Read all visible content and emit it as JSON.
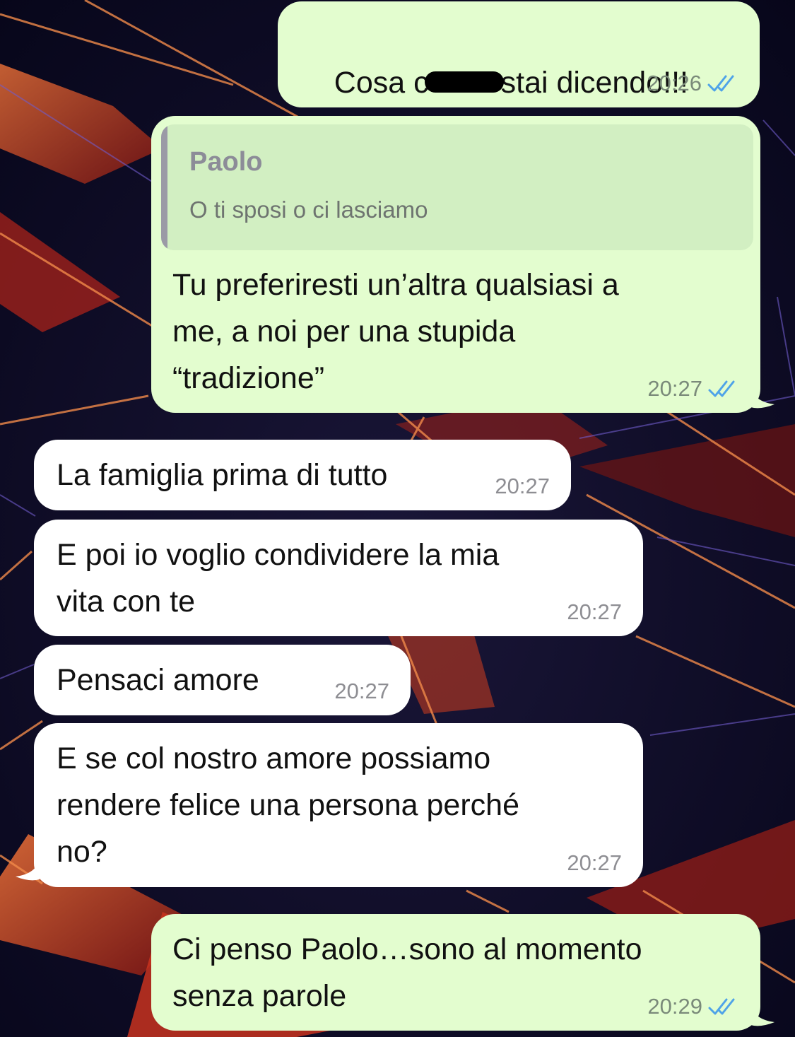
{
  "messages": [
    {
      "direction": "outgoing",
      "text_before": "Cosa c",
      "text_after": "stai dicendo!!!",
      "redacted": true,
      "time": "20:26",
      "status": "read"
    },
    {
      "direction": "outgoing",
      "reply": {
        "name": "Paolo",
        "text": "O ti sposi o ci lasciamo"
      },
      "text": "Tu preferiresti un’altra qualsiasi a\nme, a noi per una stupida\n“tradizione”",
      "time": "20:27",
      "status": "read"
    },
    {
      "direction": "incoming",
      "text": "La famiglia prima di tutto",
      "time": "20:27"
    },
    {
      "direction": "incoming",
      "text": "E poi io voglio condividere la mia\nvita con te",
      "time": "20:27"
    },
    {
      "direction": "incoming",
      "text": "Pensaci amore",
      "time": "20:27"
    },
    {
      "direction": "incoming",
      "text": "E se col nostro amore possiamo\nrendere felice una persona perché\nno?",
      "time": "20:27"
    },
    {
      "direction": "outgoing",
      "text": "Ci penso Paolo…sono al momento\nsenza parole",
      "time": "20:29",
      "status": "read"
    }
  ],
  "colors": {
    "outgoing_bubble": "#e3fdcf",
    "incoming_bubble": "#ffffff",
    "read_ticks": "#4fa3e8",
    "wallpaper_base": "#0d0b24",
    "wallpaper_accent": "#e0432a"
  },
  "icons": {
    "read_receipt": "double-check-icon",
    "redaction": "redaction-mark"
  }
}
